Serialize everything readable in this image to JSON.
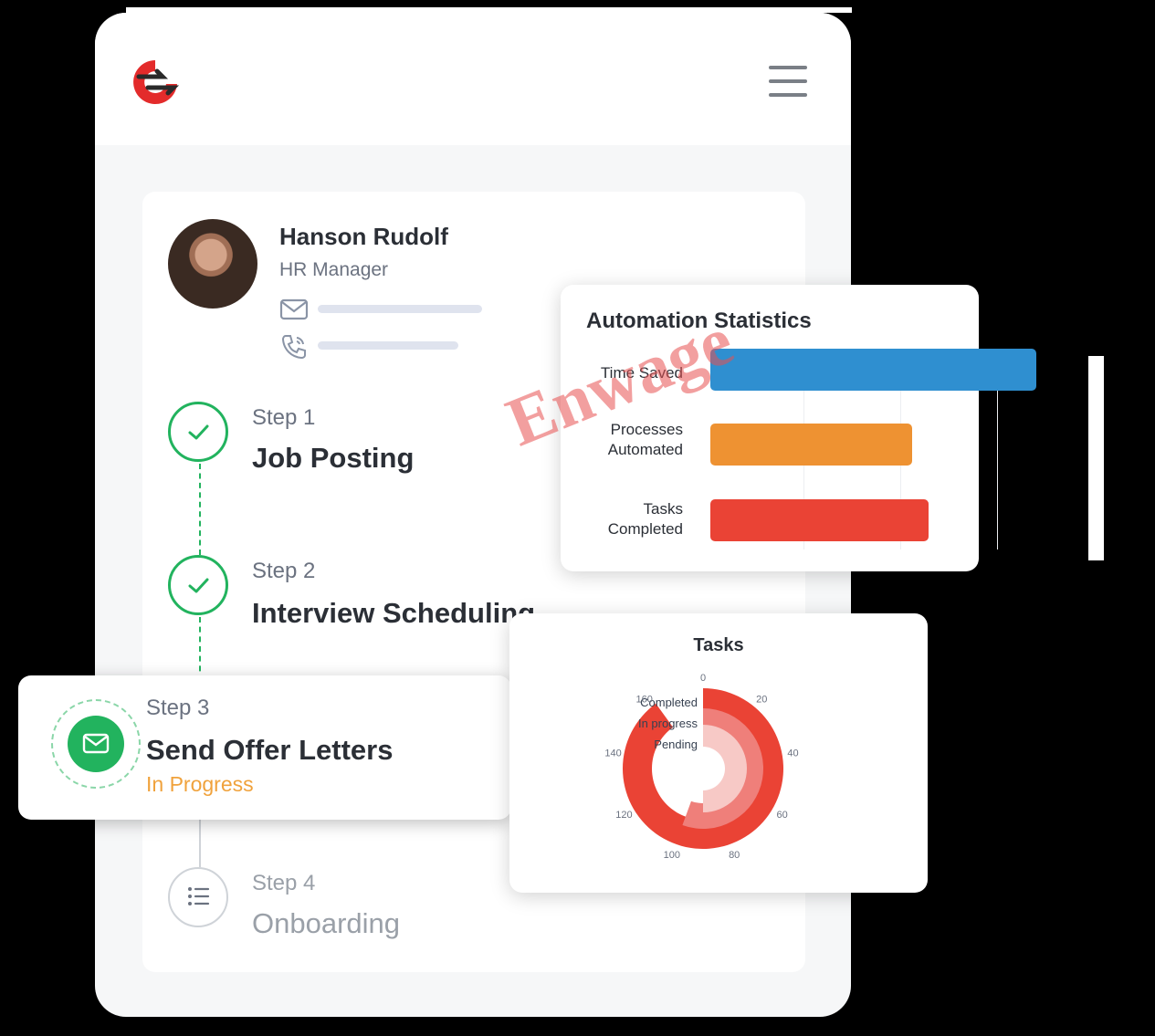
{
  "profile": {
    "name": "Hanson Rudolf",
    "role": "HR Manager"
  },
  "steps": [
    {
      "number": "Step 1",
      "title": "Job Posting",
      "status": "done"
    },
    {
      "number": "Step 2",
      "title": "Interview Scheduling",
      "status": "done"
    },
    {
      "number": "Step 3",
      "title": "Send Offer Letters",
      "status_label": "In Progress"
    },
    {
      "number": "Step 4",
      "title": "Onboarding",
      "status": "pending"
    }
  ],
  "colors": {
    "green": "#22b35e",
    "orange_status": "#f0a23c",
    "blue_bar": "#2f8fd0",
    "orange_bar": "#ee9232",
    "red_bar": "#ea4335",
    "logo_red": "#e32b2b"
  },
  "icons": [
    "logo-icon",
    "hamburger-menu-icon",
    "mail-icon",
    "phone-icon",
    "check-icon",
    "list-icon"
  ],
  "automation": {
    "title": "Automation Statistics",
    "bars": [
      {
        "label_lines": [
          "Time Saved"
        ],
        "value": 1.0,
        "color": "#2f8fd0"
      },
      {
        "label_lines": [
          "Processes",
          "Automated"
        ],
        "value": 0.62,
        "color": "#ee9232"
      },
      {
        "label_lines": [
          "Tasks",
          "Completed"
        ],
        "value": 0.67,
        "color": "#ea4335"
      }
    ]
  },
  "tasks_chart": {
    "title": "Tasks",
    "legend": [
      "Completed",
      "In progress",
      "Pending"
    ],
    "ticks": [
      "0",
      "20",
      "40",
      "60",
      "80",
      "100",
      "120",
      "140",
      "160"
    ],
    "max": 180,
    "series": [
      {
        "name": "Completed",
        "value": 162,
        "color": "#ea4335"
      },
      {
        "name": "In progress",
        "value": 100,
        "color": "#ef7f7a"
      },
      {
        "name": "Pending",
        "value": 90,
        "color": "#f7c9c6"
      }
    ]
  },
  "watermark": "Enwage"
}
